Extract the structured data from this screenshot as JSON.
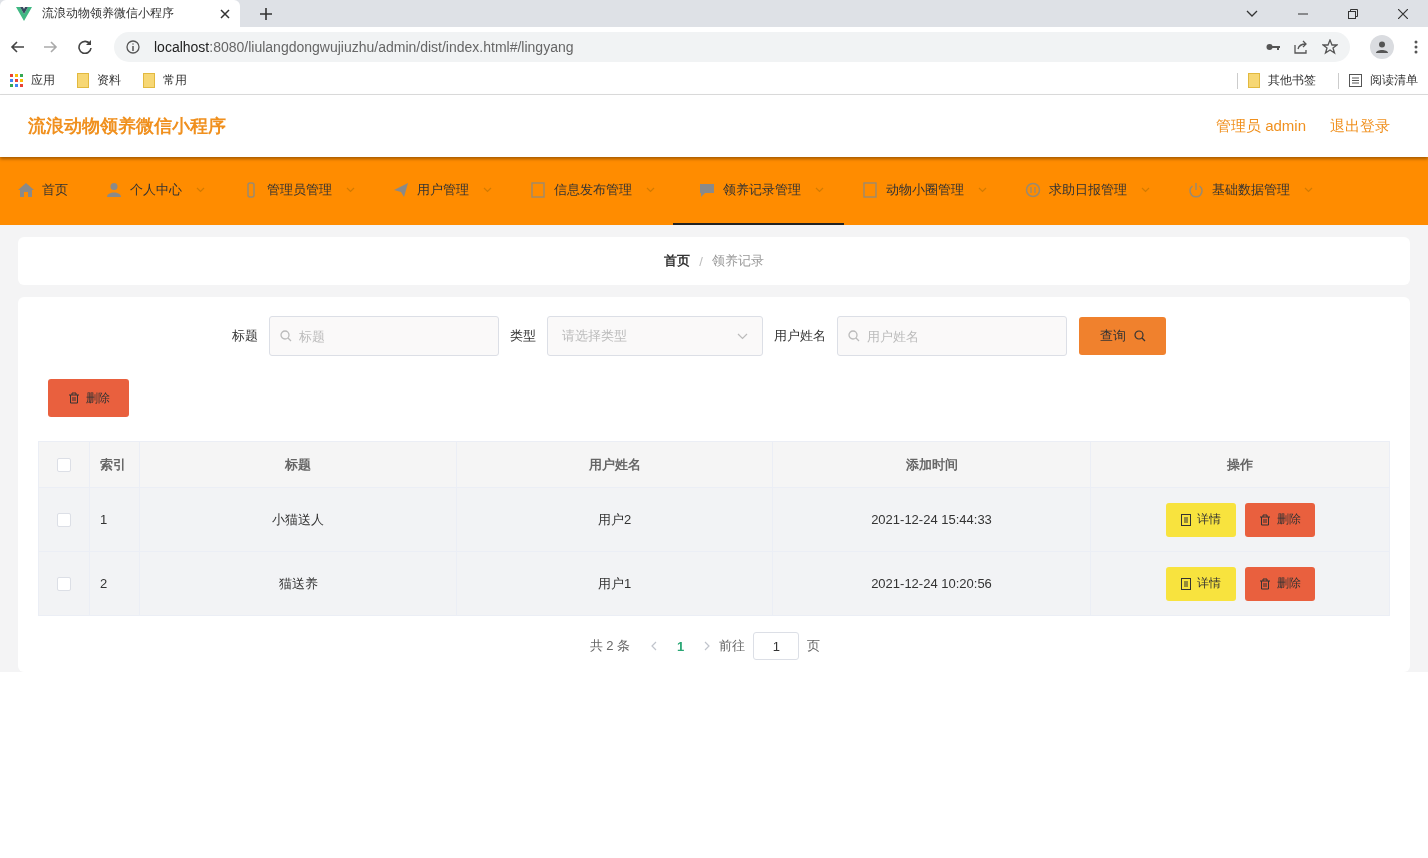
{
  "browser": {
    "tab_title": "流浪动物领养微信小程序",
    "url_host": "localhost",
    "url_path": ":8080/liulangdongwujiuzhu/admin/dist/index.html#/lingyang",
    "bookmarks": [
      {
        "label": "应用",
        "kind": "apps"
      },
      {
        "label": "资料",
        "kind": "folder"
      },
      {
        "label": "常用",
        "kind": "folder"
      }
    ],
    "right_bookmarks": [
      {
        "label": "其他书签",
        "kind": "folder"
      },
      {
        "label": "阅读清单",
        "kind": "list"
      }
    ]
  },
  "header": {
    "title": "流浪动物领养微信小程序",
    "user": "管理员 admin",
    "logout": "退出登录"
  },
  "nav": [
    {
      "label": "首页",
      "caret": false,
      "selected": false
    },
    {
      "label": "个人中心",
      "caret": true,
      "selected": false
    },
    {
      "label": "管理员管理",
      "caret": true,
      "selected": false
    },
    {
      "label": "用户管理",
      "caret": true,
      "selected": false
    },
    {
      "label": "信息发布管理",
      "caret": true,
      "selected": false
    },
    {
      "label": "领养记录管理",
      "caret": true,
      "selected": true
    },
    {
      "label": "动物小圈管理",
      "caret": true,
      "selected": false
    },
    {
      "label": "求助日报管理",
      "caret": true,
      "selected": false
    },
    {
      "label": "基础数据管理",
      "caret": true,
      "selected": false
    }
  ],
  "breadcrumb": [
    "首页",
    "领养记录"
  ],
  "breadcrumb_separator": "/",
  "filters": [
    {
      "label": "标题",
      "placeholder": "标题",
      "kind": "text"
    },
    {
      "label": "类型",
      "placeholder": "请选择类型",
      "kind": "select"
    },
    {
      "label": "用户姓名",
      "placeholder": "用户姓名",
      "kind": "text"
    }
  ],
  "query_button": "查询",
  "delete_button": "删除",
  "table": {
    "all_checked": false,
    "columns": [
      "索引",
      "标题",
      "用户姓名",
      "添加时间",
      "操作"
    ],
    "rows": [
      {
        "checked": false,
        "cells": [
          "1",
          "小猫送人",
          "用户2",
          "2021-12-24 15:44:33"
        ],
        "actions": [
          "详情",
          "删除"
        ]
      },
      {
        "checked": false,
        "cells": [
          "2",
          "猫送养",
          "用户1",
          "2021-12-24 10:20:56"
        ],
        "actions": [
          "详情",
          "删除"
        ]
      }
    ]
  },
  "pagination": {
    "total": "共 2 条",
    "pages": [
      {
        "label": "1",
        "selected": true
      }
    ],
    "goto": "前往",
    "goto_value": "1",
    "suffix": "页"
  }
}
